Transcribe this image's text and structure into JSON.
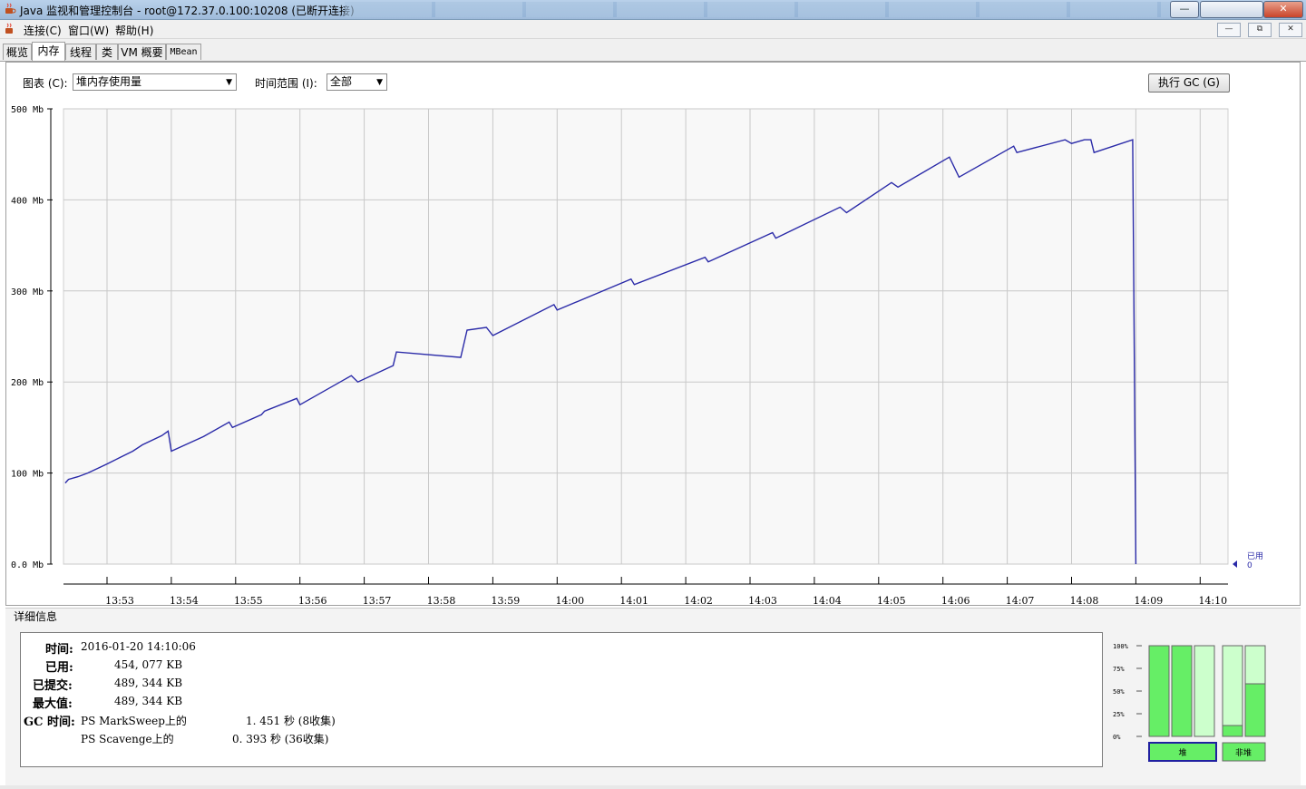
{
  "window": {
    "title": "Java 监视和管理控制台 - root@172.37.0.100:10208 (已断开连接)",
    "minimize": "—",
    "maximize": "□",
    "close": "✕"
  },
  "menu": {
    "items": [
      "连接(C)",
      "窗口(W)",
      "帮助(H)"
    ]
  },
  "mdi": {
    "minimize": "—",
    "restore": "⧉",
    "close": "✕"
  },
  "tabs": [
    "概览",
    "内存",
    "线程",
    "类",
    "VM 概要",
    "MBean"
  ],
  "active_tab": "内存",
  "icons": {
    "app": "java-coffee-icon",
    "nav": "nav-arrows-icon"
  },
  "controls": {
    "chart_label": "图表 (C):",
    "chart_value": "堆内存使用量",
    "range_label": "时间范围 (I):",
    "range_value": "全部",
    "gc_button": "执行 GC (G)"
  },
  "chart_data": {
    "type": "line",
    "ylabel_unit": "Mb",
    "yticks": [
      "500 Mb",
      "400 Mb",
      "300 Mb",
      "200 Mb",
      "100 Mb",
      "0.0 Mb"
    ],
    "ylim": [
      0,
      500
    ],
    "xticks": [
      "13:53",
      "13:54",
      "13:55",
      "13:56",
      "13:57",
      "13:58",
      "13:59",
      "14:00",
      "14:01",
      "14:02",
      "14:03",
      "14:04",
      "14:05",
      "14:06",
      "14:07",
      "14:08",
      "14:09",
      "14:10"
    ],
    "grid": true,
    "series": [
      {
        "name": "已用",
        "color": "#2a2aa8",
        "x_minutes_since_1353": [
          -0.65,
          -0.6,
          -0.45,
          -0.3,
          -0.15,
          0,
          0.2,
          0.4,
          0.55,
          0.85,
          0.95,
          1.0,
          1.5,
          1.9,
          1.95,
          2.4,
          2.45,
          2.95,
          3.0,
          3.8,
          3.9,
          4.45,
          4.5,
          5.5,
          5.6,
          5.9,
          6.0,
          6.95,
          7.0,
          8.15,
          8.2,
          9.3,
          9.35,
          10.35,
          10.4,
          11.4,
          11.5,
          12.2,
          12.3,
          13.1,
          13.25,
          14.1,
          14.15,
          14.9,
          15.0,
          15.2,
          15.3,
          15.3,
          15.35,
          15.95,
          16.0
        ],
        "y_mb": [
          89,
          93,
          96,
          100,
          105,
          110,
          117,
          124,
          131,
          141,
          146,
          124,
          140,
          156,
          150,
          164,
          168,
          182,
          175,
          207,
          200,
          218,
          233,
          227,
          257,
          260,
          251,
          285,
          279,
          313,
          307,
          337,
          332,
          364,
          358,
          392,
          386,
          419,
          414,
          447,
          425,
          459,
          452,
          466,
          462,
          466,
          466,
          466,
          452,
          466,
          0
        ]
      }
    ],
    "legend": {
      "name": "已用",
      "value": "0"
    }
  },
  "details": {
    "title": "详细信息",
    "rows": [
      {
        "key": "时间:",
        "value": "2016-01-20 14:10:06"
      },
      {
        "key": "已用:",
        "value": "454, 077 KB"
      },
      {
        "key": "已提交:",
        "value": "489, 344 KB"
      },
      {
        "key": "最大值:",
        "value": "489, 344 KB"
      }
    ],
    "gc_key": "GC 时间:",
    "gc": [
      {
        "name": "PS MarkSweep上的",
        "time": "1. 451 秒 (8收集)"
      },
      {
        "name": "PS Scavenge上的",
        "time": "0. 393 秒 (36收集)"
      }
    ]
  },
  "pools": {
    "yticks": [
      "100%",
      "75%",
      "50%",
      "25%",
      "0%"
    ],
    "heap_bars": [
      1.0,
      1.0,
      0.0
    ],
    "nonheap_bars": [
      0.12,
      0.58
    ],
    "heap_label": "堆",
    "nonheap_label": "非堆",
    "fill_color": "#66ee66",
    "empty_color": "#ccffcc"
  }
}
